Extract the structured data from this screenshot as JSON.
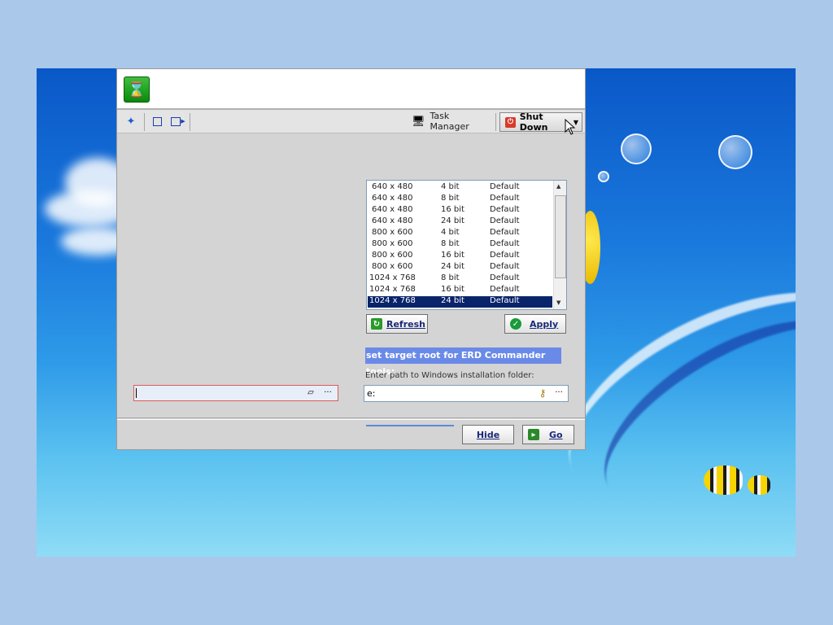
{
  "toolbar": {
    "task_manager_label": "Task Manager",
    "shut_down_label": "Shut Down"
  },
  "display": {
    "resolutions": [
      {
        "size": "640 x 480",
        "depth": "4 bit",
        "freq": "Default"
      },
      {
        "size": "640 x 480",
        "depth": "8 bit",
        "freq": "Default"
      },
      {
        "size": "640 x 480",
        "depth": "16 bit",
        "freq": "Default"
      },
      {
        "size": "640 x 480",
        "depth": "24 bit",
        "freq": "Default"
      },
      {
        "size": "800 x 600",
        "depth": "4 bit",
        "freq": "Default"
      },
      {
        "size": "800 x 600",
        "depth": "8 bit",
        "freq": "Default"
      },
      {
        "size": "800 x 600",
        "depth": "16 bit",
        "freq": "Default"
      },
      {
        "size": "800 x 600",
        "depth": "24 bit",
        "freq": "Default"
      },
      {
        "size": "1024 x 768",
        "depth": "8 bit",
        "freq": "Default"
      },
      {
        "size": "1024 x 768",
        "depth": "16 bit",
        "freq": "Default"
      },
      {
        "size": "1024 x 768",
        "depth": "24 bit",
        "freq": "Default"
      }
    ],
    "selected_index": 10,
    "refresh_label": "Refresh",
    "apply_label": "Apply"
  },
  "target_root": {
    "banner": "set target root for ERD Commander tools:",
    "path_label": "Enter path to Windows installation folder:",
    "path_value": "e:"
  },
  "footer": {
    "hide_label": "Hide",
    "go_label": "Go"
  },
  "colors": {
    "selection": "#0a246a",
    "banner": "#6a8ae8",
    "app_icon": "#14a014"
  }
}
